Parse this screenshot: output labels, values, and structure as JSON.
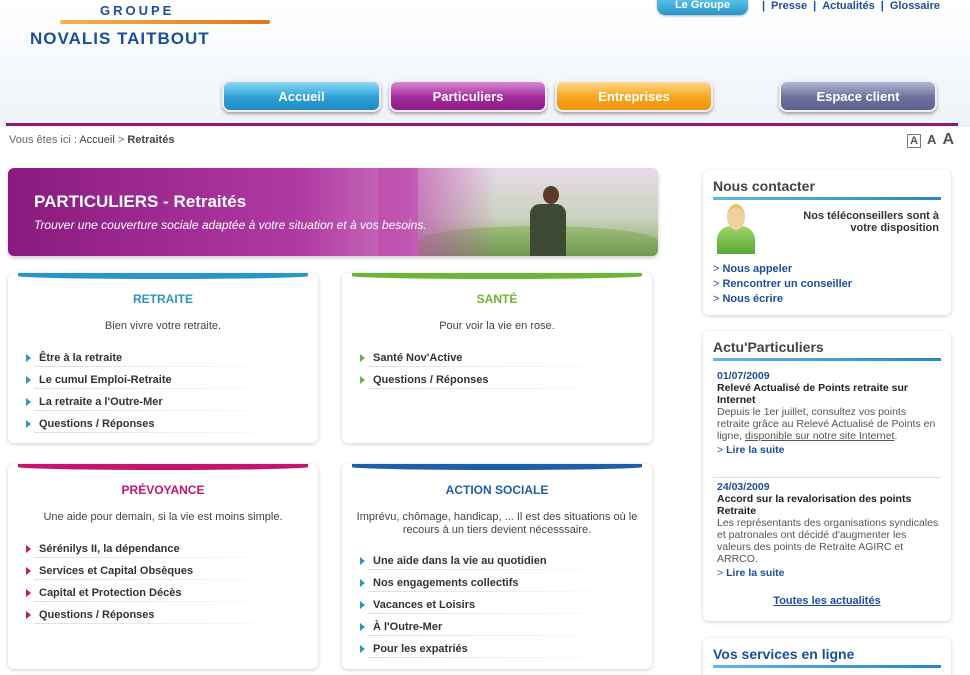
{
  "header": {
    "logo_top": "GROUPE",
    "logo_main": "NOVALIS TAITBOUT",
    "top_links": [
      "Le Groupe",
      "Presse",
      "Actualités",
      "Glossaire"
    ],
    "separator": "|",
    "nav": {
      "accueil": "Accueil",
      "particuliers": "Particuliers",
      "entreprises": "Entreprises",
      "espace_client": "Espace client"
    }
  },
  "breadcrumb": {
    "prefix": "Vous êtes ici :",
    "home": "Accueil",
    "sep": ">",
    "current": "Retraités"
  },
  "font_size": [
    "A",
    "A",
    "A"
  ],
  "banner": {
    "title": "PARTICULIERS - Retraités",
    "subtitle": "Trouver une couverture sociale adaptée à votre situation et à vos besoins."
  },
  "cards": {
    "retraite": {
      "title": "RETRAITE",
      "color": "#2a95c9",
      "desc": "Bien vivre votre retraite.",
      "items": [
        "Être à la retraite",
        "Le cumul Emploi-Retraite",
        "La retraite a l'Outre-Mer",
        "Questions / Réponses"
      ]
    },
    "sante": {
      "title": "SANTÉ",
      "color": "#6cb43a",
      "desc": "Pour voir la vie en rose.",
      "items": [
        "Santé Nov'Active",
        "Questions / Réponses"
      ]
    },
    "prevoyance": {
      "title": "PRÉVOYANCE",
      "color": "#c4166d",
      "desc": "Une aide pour demain, si la vie est moins simple.",
      "items": [
        "Sérénilys II, la dépendance",
        "Services et Capital Obsèques",
        "Capital et Protection Décès",
        "Questions / Réponses"
      ]
    },
    "action": {
      "title": "ACTION SOCIALE",
      "color": "#1d5fa8",
      "desc": "Imprévu, chômage, handicap, ... Il est des situations où le recours à un tiers devient nécesssaire.",
      "items": [
        "Une aide dans la vie au quotidien",
        "Nos engagements collectifs",
        "Vacances et Loisirs",
        "À l'Outre-Mer",
        "Pour les expatriés"
      ]
    }
  },
  "contact": {
    "title": "Nous contacter",
    "text": "Nos téléconseillers sont à votre disposition",
    "links": [
      "Nous appeler",
      "Rencontrer un conseiller",
      "Nous écrire"
    ]
  },
  "actu": {
    "title": "Actu'Particuliers",
    "news": [
      {
        "date": "01/07/2009",
        "headline": "Relevé Actualisé de Points retraite sur Internet",
        "body": "Depuis le 1er juillet, consultez vos points retraite grâce au Relevé Actualisé de Points en ligne, ",
        "link": "disponible sur notre site Internet",
        "end": ".",
        "more": "Lire la suite"
      },
      {
        "date": "24/03/2009",
        "headline": "Accord sur la revalorisation des points Retraite",
        "body": "Les représentants des organisations syndicales et patronales ont décidé d'augmenter les valeurs des points de Retraite AGIRC et ARRCO.",
        "more": "Lire la suite"
      }
    ],
    "all": "Toutes les actualités"
  },
  "services": {
    "title": "Vos services en ligne"
  }
}
